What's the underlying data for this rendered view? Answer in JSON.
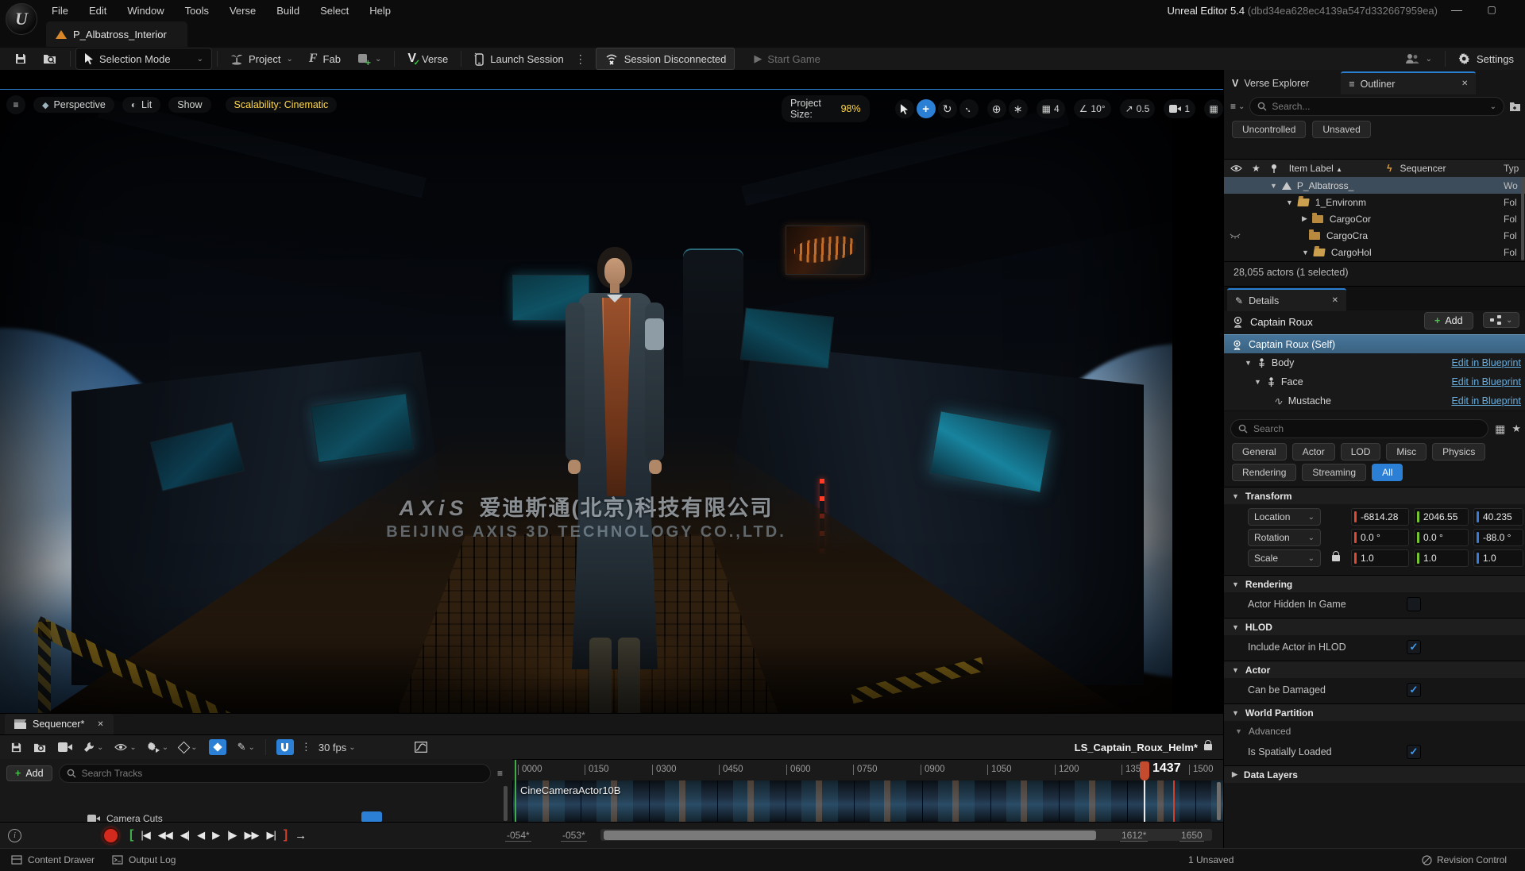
{
  "window": {
    "logo": "U",
    "menu": [
      "File",
      "Edit",
      "Window",
      "Tools",
      "Verse",
      "Build",
      "Select",
      "Help"
    ],
    "title": "Unreal Editor 5.4",
    "title_id": "(dbd34ea628ec4139a547d332667959ea)",
    "tab": "P_Albatross_Interior"
  },
  "toolbar": {
    "selection_mode": "Selection Mode",
    "project": "Project",
    "fab": "Fab",
    "verse": "Verse",
    "launch_session": "Launch Session",
    "session_status": "Session Disconnected",
    "start_game": "Start Game",
    "settings": "Settings"
  },
  "viewport": {
    "perspective": "Perspective",
    "lit": "Lit",
    "show": "Show",
    "scalability": "Scalability: Cinematic",
    "project_size": "Project Size:",
    "project_size_value": "98%",
    "grid_snap": "4",
    "angle_snap": "10°",
    "scale_snap": "0.5",
    "camera_speed": "1",
    "watermark_logo": "AXiS",
    "watermark_cn": "爱迪斯通(北京)科技有限公司",
    "watermark_en": "BEIJING AXIS 3D TECHNOLOGY CO.,LTD."
  },
  "outliner": {
    "tab_verse": "Verse Explorer",
    "tab_outliner": "Outliner",
    "search_placeholder": "Search...",
    "btn_uncontrolled": "Uncontrolled",
    "btn_unsaved": "Unsaved",
    "col_item_label": "Item Label",
    "col_sequencer": "Sequencer",
    "col_type": "Typ",
    "rows": [
      {
        "label": "P_Albatross_",
        "type": "Wo"
      },
      {
        "label": "1_Environm",
        "type": "Fol"
      },
      {
        "label": "CargoCor",
        "type": "Fol"
      },
      {
        "label": "CargoCra",
        "type": "Fol"
      },
      {
        "label": "CargoHol",
        "type": "Fol"
      }
    ],
    "status": "28,055 actors (1 selected)"
  },
  "details": {
    "tab": "Details",
    "actor_name": "Captain Roux",
    "add_label": "Add",
    "self_row": "Captain Roux (Self)",
    "components": [
      {
        "label": "Body",
        "link": "Edit in Blueprint"
      },
      {
        "label": "Face",
        "link": "Edit in Blueprint"
      },
      {
        "label": "Mustache",
        "link": "Edit in Blueprint"
      }
    ],
    "search_placeholder": "Search",
    "filters": [
      "General",
      "Actor",
      "LOD",
      "Misc",
      "Physics",
      "Rendering",
      "Streaming",
      "All"
    ],
    "transform": {
      "title": "Transform",
      "location_label": "Location",
      "rotation_label": "Rotation",
      "scale_label": "Scale",
      "location": [
        "-6814.28",
        "2046.55",
        "40.235"
      ],
      "rotation": [
        "0.0 °",
        "0.0 °",
        "-88.0 °"
      ],
      "scale": [
        "1.0",
        "1.0",
        "1.0"
      ]
    },
    "sec_rendering": "Rendering",
    "row_hidden": "Actor Hidden In Game",
    "sec_hlod": "HLOD",
    "row_hlod": "Include Actor in HLOD",
    "sec_actor": "Actor",
    "row_damage": "Can be Damaged",
    "sec_wp": "World Partition",
    "sec_advanced": "Advanced",
    "row_spatial": "Is Spatially Loaded",
    "sec_datalayers": "Data Layers",
    "check": "✓"
  },
  "sequencer": {
    "tab": "Sequencer*",
    "fps": "30 fps",
    "add_label": "Add",
    "search_placeholder": "Search Tracks",
    "sequence_name": "LS_Captain_Roux_Helm*",
    "track_camera": "CineCameraActor10B",
    "track_camera_cuts": "Camera Cuts",
    "ticks": [
      "0000",
      "0150",
      "0300",
      "0450",
      "0600",
      "0750",
      "0900",
      "1050",
      "1200",
      "1350",
      "1500"
    ],
    "current_frame": "1437",
    "range_a": "-054*",
    "range_b": "-053*",
    "range_c": "1612*",
    "range_d": "1650"
  },
  "statusbar": {
    "content_drawer": "Content Drawer",
    "output_log": "Output Log",
    "unsaved": "1 Unsaved",
    "revision": "Revision Control"
  },
  "icons": {
    "chevron": "⌄",
    "dots": "⋮",
    "tri_down": "▼",
    "tri_right": "▶",
    "close": "✕",
    "sort": "▲",
    "star": "★",
    "bolt": "ϟ",
    "plus": "+",
    "hamburger": "≡",
    "cube": "◆",
    "sphere": "◐",
    "grid": "▦",
    "angle": "∠",
    "diag": "↗",
    "globe": "⊕",
    "rotate": "↻",
    "move": "+",
    "scale_tool": "↔",
    "axes": "∗",
    "to_start": "|◀",
    "rew": "◀◀",
    "step_back": "◀|",
    "play_rev": "◀",
    "play": "▶",
    "step_fwd": "|▶",
    "ffwd": "▶▶",
    "to_end": "▶|",
    "bracket_open": "[",
    "bracket_close": "]",
    "arrow_right": "→",
    "info": "i",
    "minimize": "—",
    "maximize": "▢",
    "vcheck": "✓",
    "pencil": "✎",
    "wave": "∿",
    "eye_col": "",
    "fab_f": "F",
    "verse_v": "V"
  },
  "colors": {
    "accent_blue": "#2b7fd4",
    "selection_blue": "#3a627f",
    "warning_yellow": "#ffd84a",
    "axis_red": "#e0492f",
    "axis_green": "#76c42f",
    "axis_blue": "#3a7bd5",
    "playhead": "#c44b2e",
    "record_red": "#d42a1e"
  }
}
